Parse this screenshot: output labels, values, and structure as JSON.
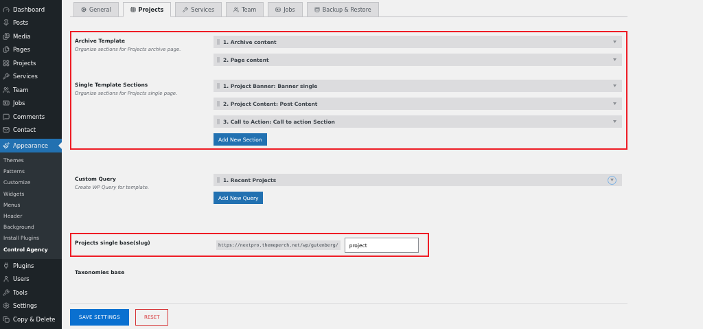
{
  "sidebar": {
    "items": [
      {
        "label": "Dashboard",
        "selected": false
      },
      {
        "label": "Posts",
        "selected": false
      },
      {
        "label": "Media",
        "selected": false
      },
      {
        "label": "Pages",
        "selected": false
      },
      {
        "label": "Projects",
        "selected": false
      },
      {
        "label": "Services",
        "selected": false
      },
      {
        "label": "Team",
        "selected": false
      },
      {
        "label": "Jobs",
        "selected": false
      },
      {
        "label": "Comments",
        "selected": false
      },
      {
        "label": "Contact",
        "selected": false
      },
      {
        "label": "Appearance",
        "selected": true,
        "children": [
          {
            "label": "Themes",
            "selected": false
          },
          {
            "label": "Patterns",
            "selected": false
          },
          {
            "label": "Customize",
            "selected": false
          },
          {
            "label": "Widgets",
            "selected": false
          },
          {
            "label": "Menus",
            "selected": false
          },
          {
            "label": "Header",
            "selected": false
          },
          {
            "label": "Background",
            "selected": false
          },
          {
            "label": "Install Plugins",
            "selected": false
          },
          {
            "label": "Control Agency",
            "selected": true
          }
        ]
      },
      {
        "label": "Plugins",
        "selected": false
      },
      {
        "label": "Users",
        "selected": false
      },
      {
        "label": "Tools",
        "selected": false
      },
      {
        "label": "Settings",
        "selected": false
      },
      {
        "label": "Copy & Delete",
        "selected": false
      }
    ]
  },
  "tabs": [
    {
      "label": "General",
      "selected": false
    },
    {
      "label": "Projects",
      "selected": true
    },
    {
      "label": "Services",
      "selected": false
    },
    {
      "label": "Team",
      "selected": false
    },
    {
      "label": "Jobs",
      "selected": false
    },
    {
      "label": "Backup & Restore",
      "selected": false
    }
  ],
  "groups": [
    {
      "highlighted": true,
      "fields": [
        {
          "label": "Archive Template",
          "description": "Organize sections for Projects archive page.",
          "items": [
            {
              "label": "1. Archive content",
              "kind": "arrow"
            },
            {
              "label": "2. Page content",
              "kind": "arrow"
            }
          ]
        },
        {
          "label": "Single Template Sections",
          "description": "Organize sections for Projects single page.",
          "items": [
            {
              "label": "1. Project Banner: Banner single",
              "kind": "arrow"
            },
            {
              "label": "2. Project Content: Post Content",
              "kind": "arrow"
            },
            {
              "label": "3. Call to Action: Call to action Section",
              "kind": "arrow"
            }
          ],
          "button": "Add New Section"
        }
      ]
    },
    {
      "highlighted": false,
      "fields": [
        {
          "label": "Custom Query",
          "description": "Create WP Query for template.",
          "items": [
            {
              "label": "1. Recent Projects",
              "kind": "circle"
            }
          ],
          "button": "Add New Query"
        }
      ]
    }
  ],
  "slug": {
    "highlighted": true,
    "label": "Projects single base(slug)",
    "prefix": "https://nextpro.themeperch.net/wp/gutenberg/",
    "value": "project"
  },
  "taxonomies": {
    "label": "Taxonomies base"
  },
  "actions": {
    "save": "SAVE SETTINGS",
    "reset": "RESET"
  }
}
